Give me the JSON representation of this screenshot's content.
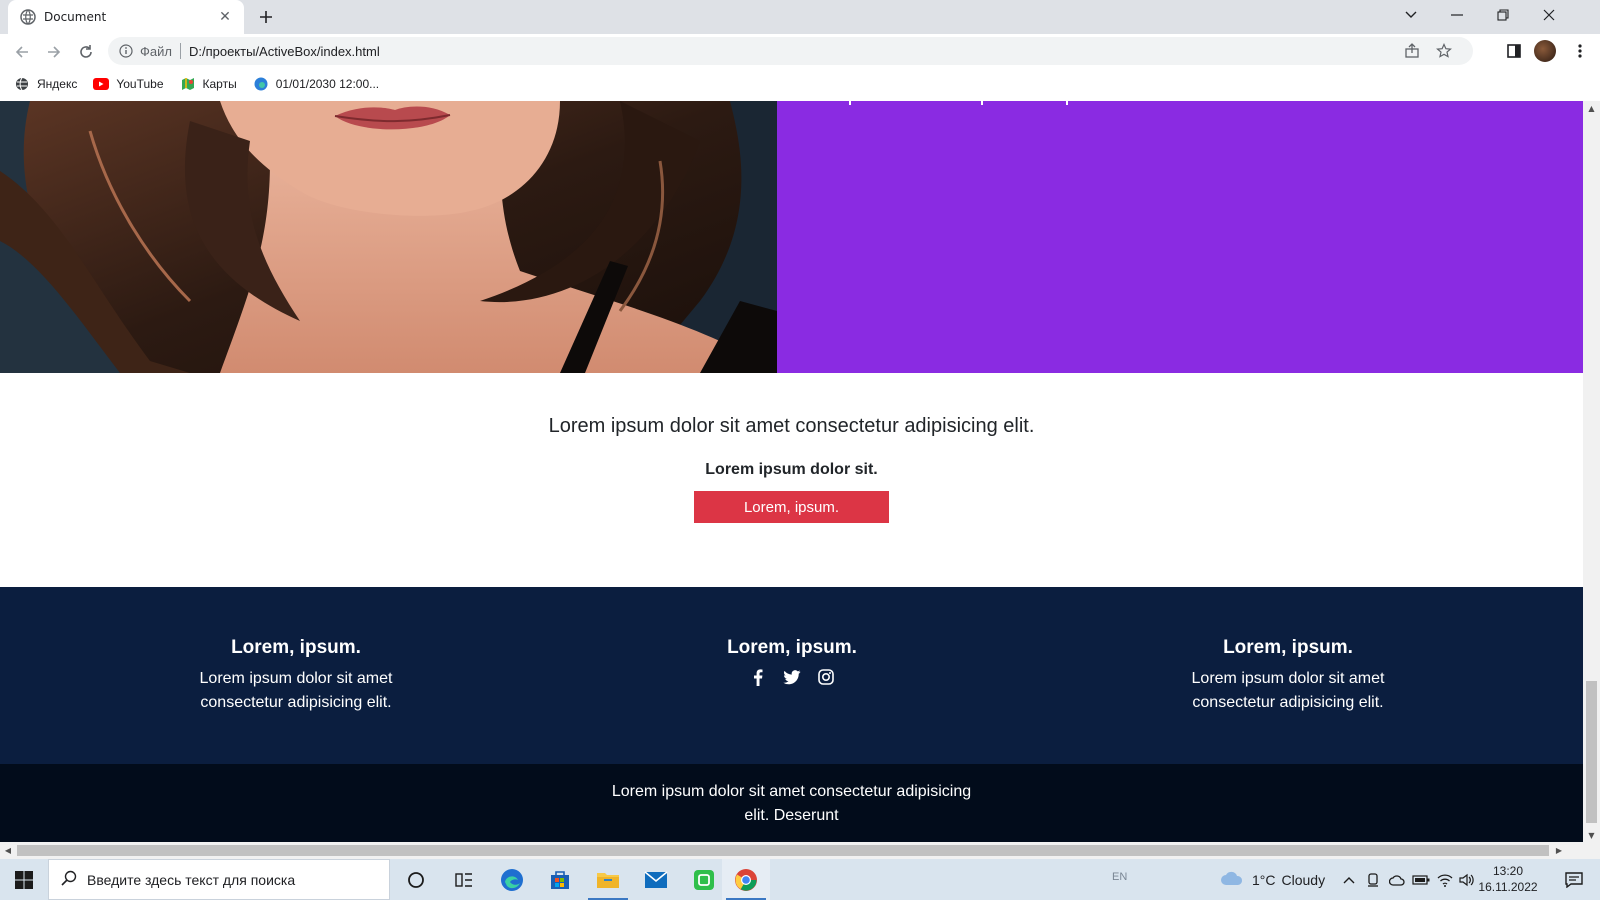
{
  "browser": {
    "tab_title": "Document",
    "address": {
      "scheme_label": "Файл",
      "url": "D:/проекты/ActiveBox/index.html"
    },
    "bookmarks": [
      {
        "label": "Яндекс",
        "icon": "globe-icon"
      },
      {
        "label": "YouTube",
        "icon": "youtube-icon"
      },
      {
        "label": "Карты",
        "icon": "maps-icon"
      },
      {
        "label": "01/01/2030 12:00...",
        "icon": "edge-icon"
      }
    ]
  },
  "page": {
    "cta": {
      "lead": "Lorem ipsum dolor sit amet consectetur adipisicing elit.",
      "strong": "Lorem ipsum dolor sit.",
      "button": "Lorem, ipsum."
    },
    "footer": {
      "columns": [
        {
          "title": "Lorem, ipsum.",
          "text_line1": "Lorem ipsum dolor sit amet",
          "text_line2": "consectetur adipisicing elit."
        },
        {
          "title": "Lorem, ipsum.",
          "social": [
            "facebook-icon",
            "twitter-icon",
            "instagram-icon"
          ]
        },
        {
          "title": "Lorem, ipsum.",
          "text_line1": "Lorem ipsum dolor sit amet",
          "text_line2": "consectetur adipisicing elit."
        }
      ],
      "bottom_line1": "Lorem ipsum dolor sit amet consectetur adipisicing",
      "bottom_line2": "elit. Deserunt"
    },
    "colors": {
      "hero_purple": "#8a2be2",
      "button_red": "#dc3545",
      "footer_navy": "#0b1e3f",
      "footer_dark": "#020c1b"
    }
  },
  "taskbar": {
    "search_placeholder": "Введите здесь текст для поиска",
    "language": "EN",
    "weather": {
      "temp": "1°C",
      "condition": "Cloudy"
    },
    "clock": {
      "time": "13:20",
      "date": "16.11.2022"
    }
  }
}
